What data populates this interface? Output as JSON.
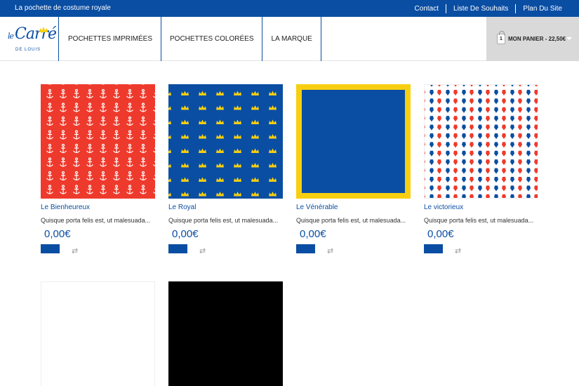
{
  "topbar": {
    "tagline": "La pochette de costume royale",
    "links": [
      "Contact",
      "Liste De Souhaits",
      "Plan Du Site"
    ]
  },
  "logo": {
    "script_small": "le",
    "script": "Carré",
    "sub": "DE LOUIS"
  },
  "nav": {
    "items": [
      "POCHETTES IMPRIMÉES",
      "POCHETTES COLORÉES",
      "LA MARQUE"
    ]
  },
  "cart": {
    "count": "1",
    "label": "MON PANIER - 22,50€"
  },
  "products": [
    {
      "name": "Le Bienheureux",
      "desc": "Quisque porta felis est, ut malesuada...",
      "price": "0,00€"
    },
    {
      "name": "Le Royal",
      "desc": "Quisque porta felis est, ut malesuada...",
      "price": "0,00€"
    },
    {
      "name": "Le Vénérable",
      "desc": "Quisque porta felis est, ut malesuada...",
      "price": "0,00€"
    },
    {
      "name": "Le victorieux",
      "desc": "Quisque porta felis est, ut malesuada...",
      "price": "0,00€"
    }
  ],
  "colors": {
    "brand_blue": "#0a4ea3",
    "red": "#ee3a2c",
    "yellow": "#f7cf10"
  }
}
